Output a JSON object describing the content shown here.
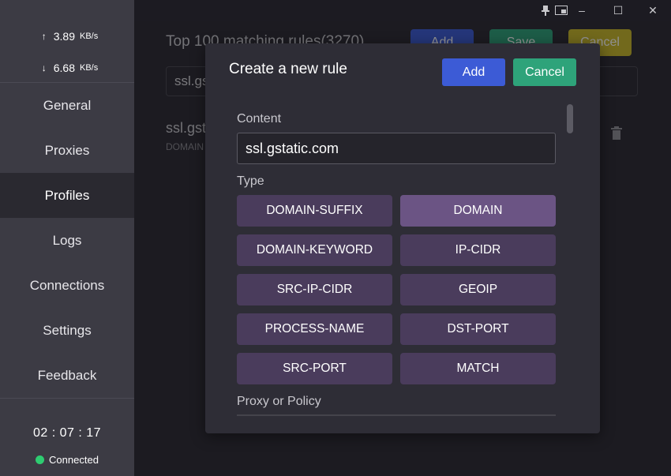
{
  "sidebar": {
    "upload_speed": {
      "arrow": "↑",
      "value": "3.89",
      "unit": "KB/s"
    },
    "download_speed": {
      "arrow": "↓",
      "value": "6.68",
      "unit": "KB/s"
    },
    "items": [
      {
        "label": "General"
      },
      {
        "label": "Proxies"
      },
      {
        "label": "Profiles",
        "active": true
      },
      {
        "label": "Logs"
      },
      {
        "label": "Connections"
      },
      {
        "label": "Settings"
      },
      {
        "label": "Feedback"
      }
    ],
    "clock": "02 : 07 : 17",
    "status": "Connected"
  },
  "titlebar": {
    "pin_icon": "pin-icon",
    "mini_icon": "mini-window-icon",
    "minimize": "–",
    "maximize": "☐",
    "close": "✕"
  },
  "background": {
    "title": "Top 100 matching rules(3270)",
    "add": "Add",
    "save": "Save",
    "cancel": "Cancel",
    "search_value": "ssl.gs",
    "rule_name": "ssl.gst",
    "rule_type": "DOMAIN"
  },
  "modal": {
    "title": "Create a new rule",
    "add_label": "Add",
    "cancel_label": "Cancel",
    "content_label": "Content",
    "content_value": "ssl.gstatic.com",
    "type_label": "Type",
    "types": [
      {
        "label": "DOMAIN-SUFFIX"
      },
      {
        "label": "DOMAIN",
        "selected": true
      },
      {
        "label": "DOMAIN-KEYWORD"
      },
      {
        "label": "IP-CIDR"
      },
      {
        "label": "SRC-IP-CIDR"
      },
      {
        "label": "GEOIP"
      },
      {
        "label": "PROCESS-NAME"
      },
      {
        "label": "DST-PORT"
      },
      {
        "label": "SRC-PORT"
      },
      {
        "label": "MATCH"
      }
    ],
    "policy_label": "Proxy or Policy"
  },
  "colors": {
    "add": "#3c5bd6",
    "cancel": "#2ea37a",
    "type_selected": "#6b5484",
    "type_default": "#4a3c5c",
    "status": "#2ecc71"
  }
}
